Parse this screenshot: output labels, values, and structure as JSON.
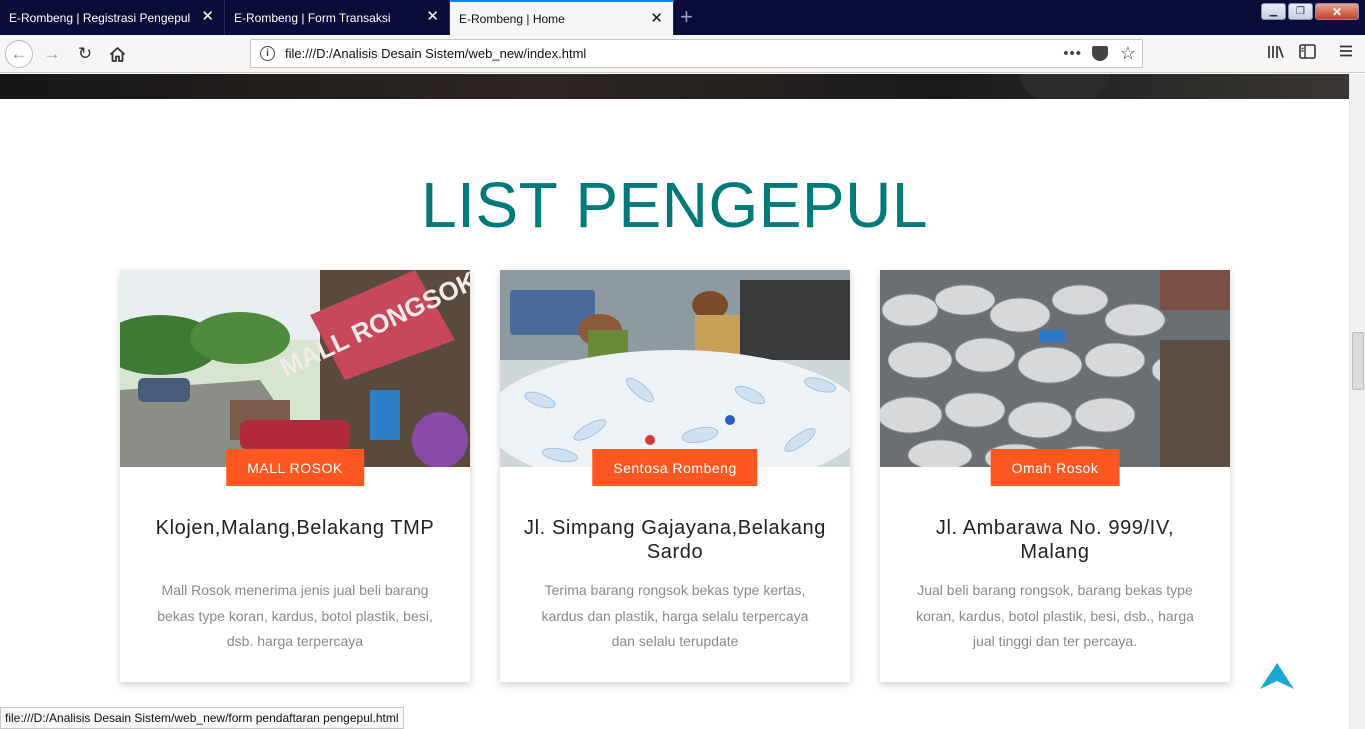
{
  "browser": {
    "tabs": [
      {
        "label": "E-Rombeng | Registrasi Pengepul",
        "active": false
      },
      {
        "label": "E-Rombeng | Form Transaksi",
        "active": false
      },
      {
        "label": "E-Rombeng | Home",
        "active": true
      }
    ],
    "url": "file:///D:/Analisis Desain Sistem/web_new/index.html",
    "status_url": "file:///D:/Analisis Desain Sistem/web_new/form pendaftaran pengepul.html"
  },
  "colors": {
    "title": "#00797a",
    "badge": "#ff5722",
    "totop": "#1aa7d0",
    "tab_active_accent": "#0a84ff"
  },
  "icons": {
    "back": "arrow-left-icon",
    "forward": "arrow-right-icon",
    "reload": "reload-icon",
    "home": "home-icon",
    "info": "info-icon",
    "more": "ellipsis-icon",
    "pocket": "pocket-icon",
    "bookmark": "star-icon",
    "library": "library-icon",
    "sidebar": "sidebar-icon",
    "menu": "hamburger-icon",
    "to_top": "arrow-up-icon"
  },
  "section": {
    "title": "LIST PENGEPUL"
  },
  "cards": [
    {
      "image_text": "MALL RONGSOK",
      "badge": "MALL ROSOK",
      "address": "Klojen,Malang,Belakang TMP",
      "description": "Mall Rosok menerima jenis jual beli barang bekas type koran, kardus, botol plastik, besi, dsb. harga terpercaya"
    },
    {
      "badge": "Sentosa Rombeng",
      "address": "Jl. Simpang Gajayana,Belakang Sardo",
      "description": "Terima barang rongsok bekas type kertas, kardus dan plastik, harga selalu terpercaya dan selalu terupdate"
    },
    {
      "badge": "Omah Rosok",
      "address": "Jl. Ambarawa No. 999/IV, Malang",
      "description": "Jual beli barang rongsok, barang bekas type koran, kardus, botol plastik, besi, dsb., harga jual tinggi dan ter percaya."
    }
  ]
}
